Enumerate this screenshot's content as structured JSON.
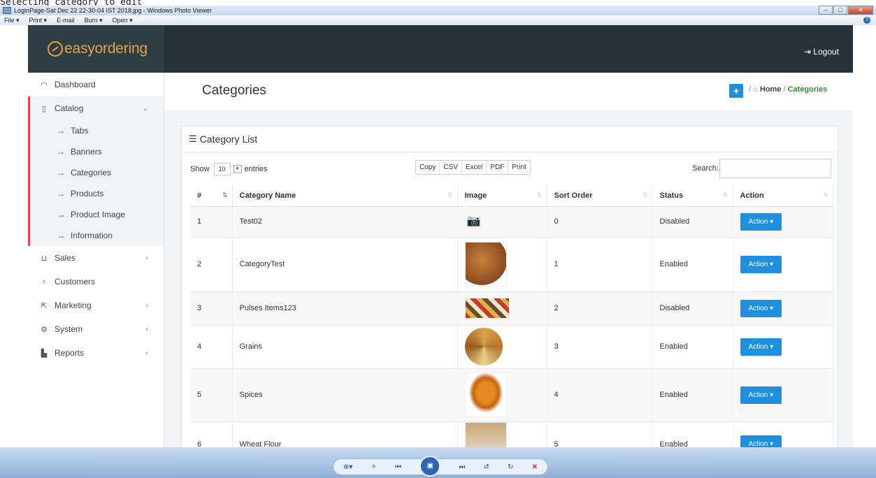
{
  "caption": "Selecting category to edit",
  "window": {
    "title": "LoginPage-Sat Dec 22 22-30-04 IST 2018.jpg - Windows Photo Viewer",
    "menu": [
      "File ▾",
      "Print ▾",
      "E-mail",
      "Burn ▾",
      "Open ▾"
    ]
  },
  "brand": {
    "logo": "easyordering",
    "logout": "Logout",
    "accent": "#e8a33a"
  },
  "sidebar": {
    "items": [
      {
        "label": "Dashboard",
        "icon": "dashboard-icon"
      },
      {
        "label": "Catalog",
        "icon": "catalog-icon"
      },
      {
        "label": "Sales",
        "icon": "cart-icon"
      },
      {
        "label": "Customers",
        "icon": "user-icon"
      },
      {
        "label": "Marketing",
        "icon": "share-icon"
      },
      {
        "label": "System",
        "icon": "gear-icon"
      },
      {
        "label": "Reports",
        "icon": "bar-chart-icon"
      }
    ],
    "catalog_sub": [
      "Tabs",
      "Banners",
      "Categories",
      "Products",
      "Product Image",
      "Information"
    ]
  },
  "page": {
    "title": "Categories",
    "crumb_home": "Home",
    "crumb_current": "Categories",
    "add": "+"
  },
  "card": {
    "title": "Category List",
    "show_label": "Show",
    "entries_value": "10",
    "entries_label": "entries",
    "export_buttons": [
      "Copy",
      "CSV",
      "Excel",
      "PDF",
      "Print"
    ],
    "search_label": "Search:",
    "columns": [
      "#",
      "Category Name",
      "Image",
      "Sort Order",
      "Status",
      "Action"
    ],
    "action_label": "Action ▾",
    "rows": [
      {
        "num": "1",
        "name": "Test02",
        "sort": "0",
        "status": "Disabled"
      },
      {
        "num": "2",
        "name": "CategoryTest",
        "sort": "1",
        "status": "Enabled"
      },
      {
        "num": "3",
        "name": "Pulses Items123",
        "sort": "2",
        "status": "Disabled"
      },
      {
        "num": "4",
        "name": "Grains",
        "sort": "3",
        "status": "Enabled"
      },
      {
        "num": "5",
        "name": "Spices",
        "sort": "4",
        "status": "Enabled"
      },
      {
        "num": "6",
        "name": "Wheat Flour",
        "sort": "5",
        "status": "Enabled"
      }
    ]
  }
}
